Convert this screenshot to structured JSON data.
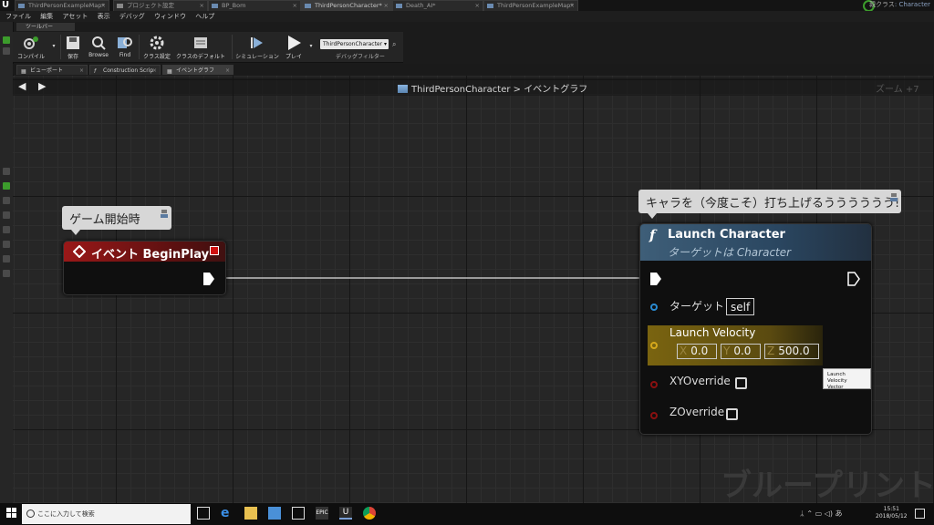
{
  "titlebar": {
    "tabs": [
      {
        "label": "ThirdPersonExampleMap*"
      },
      {
        "label": "プロジェクト設定"
      },
      {
        "label": "BP_Bom"
      },
      {
        "label": "ThirdPersonCharacter*"
      },
      {
        "label": "Death_AI*"
      },
      {
        "label": "ThirdPersonExampleMap*"
      }
    ],
    "parent_class_label": "親クラス",
    "parent_class_value": "Character"
  },
  "menu": [
    "ファイル",
    "編集",
    "アセット",
    "表示",
    "デバッグ",
    "ウィンドウ",
    "ヘルプ"
  ],
  "toolbar": {
    "panel_title": "ツールバー",
    "buttons": [
      {
        "label": "コンパイル",
        "icon": "compile-icon"
      },
      {
        "label": "保存",
        "icon": "save-icon"
      },
      {
        "label": "Browse",
        "icon": "browse-icon"
      },
      {
        "label": "Find",
        "icon": "find-icon"
      },
      {
        "label": "クラス設定",
        "icon": "class-settings-icon"
      },
      {
        "label": "クラスのデフォルト",
        "icon": "class-defaults-icon"
      },
      {
        "label": "シミュレーション",
        "icon": "simulate-icon"
      },
      {
        "label": "プレイ",
        "icon": "play-icon"
      }
    ],
    "debug_object": "ThirdPersonCharacter",
    "debug_filter_label": "デバッグフィルター"
  },
  "subtabs": [
    {
      "label": "ビューポート"
    },
    {
      "label": "Construction Scrip"
    },
    {
      "label": "イベントグラフ"
    }
  ],
  "graph": {
    "breadcrumb_blueprint": "ThirdPersonCharacter",
    "breadcrumb_sep": ">",
    "breadcrumb_graph": "イベントグラフ",
    "zoom": "ズーム +7",
    "watermark": "ブループリント"
  },
  "nodes": {
    "begin_play": {
      "comment": "ゲーム開始時",
      "title": "イベント BeginPlay"
    },
    "launch_character": {
      "comment": "キャラを（今度こそ）打ち上げるうううううう!",
      "title": "Launch Character",
      "subtitle": "ターゲットは Character",
      "target_label": "ターゲット",
      "target_value": "self",
      "velocity_label": "Launch Velocity",
      "velocity": {
        "x": "0.0",
        "y": "0.0",
        "z": "500.0"
      },
      "axis_x": "X",
      "axis_y": "Y",
      "axis_z": "Z",
      "xy_override_label": "XYOverride",
      "z_override_label": "ZOverride",
      "xy_override": false,
      "z_override": false
    },
    "tooltip_line1": "Launch Velocity",
    "tooltip_line2": "Vector"
  },
  "taskbar": {
    "search_placeholder": "ここに入力して検索",
    "time": "15:51",
    "date": "2018/05/12"
  },
  "colors": {
    "event_header": "#9a1818",
    "function_header": "#3e5e78",
    "vector_pin": "#d6a81c",
    "object_pin": "#2a8ad0",
    "bool_pin": "#8a1010"
  }
}
